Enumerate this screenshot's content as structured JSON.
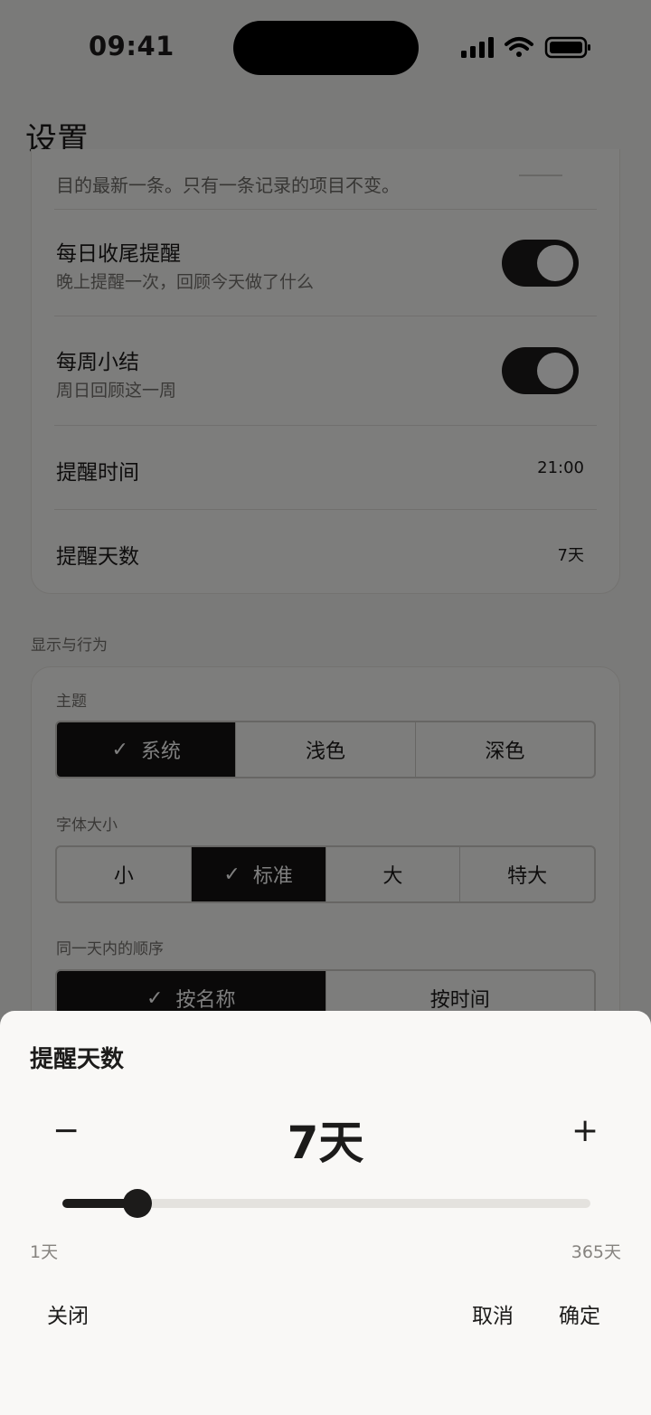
{
  "status_bar": {
    "time": "09:41"
  },
  "page": {
    "title": "设置"
  },
  "reminders": {
    "truncated_text": "目的最新一条。只有一条记录的项目不变。",
    "daily": {
      "title": "每日收尾提醒",
      "subtitle": "晚上提醒一次，回顾今天做了什么",
      "on": true
    },
    "weekly": {
      "title": "每周小结",
      "subtitle": "周日回顾这一周",
      "on": true
    },
    "time": {
      "label": "提醒时间",
      "value": "21:00"
    },
    "days": {
      "label": "提醒天数",
      "value": "7天"
    }
  },
  "display": {
    "section_label": "显示与行为",
    "theme": {
      "label": "主题",
      "options": [
        "系统",
        "浅色",
        "深色"
      ],
      "selected": 0
    },
    "font_size": {
      "label": "字体大小",
      "options": [
        "小",
        "标准",
        "大",
        "特大"
      ],
      "selected": 1
    },
    "order": {
      "label": "同一天内的顺序",
      "options": [
        "按名称",
        "按时间"
      ],
      "selected": 0
    }
  },
  "sheet": {
    "title": "提醒天数",
    "minus": "−",
    "plus": "+",
    "value_text": "7天",
    "slider": {
      "min": 1,
      "max": 365,
      "value": 7
    },
    "min_label": "1天",
    "max_label": "365天",
    "close": "关闭",
    "cancel": "取消",
    "confirm": "确定"
  },
  "check_glyph": "✓",
  "colors": {
    "accent": "#1c1b1a",
    "scrim": "rgba(0,0,0,0.5)"
  }
}
